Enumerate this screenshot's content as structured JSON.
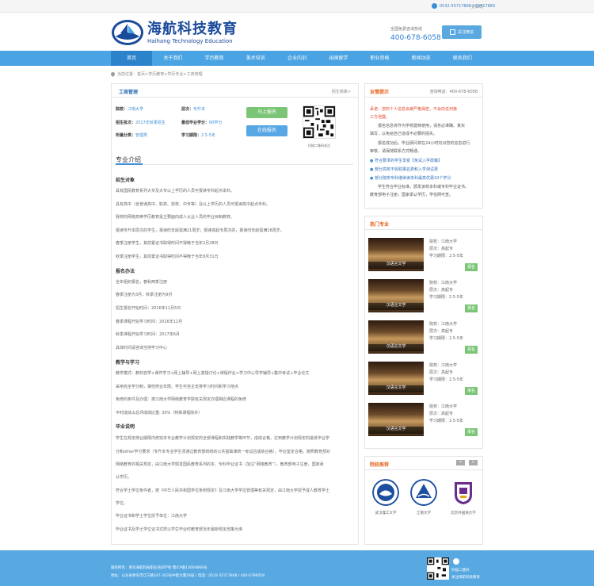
{
  "topbar": {
    "links": "分公司",
    "phone": "0532-55717868 / 55717883"
  },
  "logo": {
    "cn": "海航科技教育",
    "en": "Haihang Technology Education"
  },
  "hotline": {
    "label": "全国免费咨询热线",
    "number": "400-678-6058"
  },
  "follow_label": "关注微信",
  "nav": [
    "首页",
    "关于我们",
    "学历教育",
    "美术培训",
    "企业内训",
    "出国留学",
    "职业资格",
    "新闻动态",
    "联系我们"
  ],
  "breadcrumb": "当前位置：首页>学历教育>学历专业>工商管理",
  "program": {
    "title": "工商管理",
    "more": "招生简章>",
    "school_label": "院校：",
    "school": "江南大学",
    "level_label": "层次：",
    "level": "专升本",
    "batch_label": "招生批次：",
    "batch": "2017年秋季招生",
    "min_credit_label": "最低毕业学分：",
    "min_credit": "80学分",
    "category_label": "所属分类：",
    "category": "管理类",
    "duration_label": "学习期限：",
    "duration": "2.5-5年",
    "apply_btn": "马上报名",
    "online_btn": "在线报名",
    "qr_caption": "扫描二维码关注"
  },
  "intro": {
    "title": "专业介绍",
    "h1": "招生对象",
    "p1": "具有国民教育系列大专及大专以上学历的人员可报读专科起点本科。",
    "p2": "具有高中（含普通高中、职高、技校、中专等）及以上学历的人员可报读高中起点专科。",
    "p3": "我校的网络高等学历教育是主要面向成人从业人员的毕业目制教育。",
    "p4": "报读专升本层次的学生，报读时年龄需满21周岁；报读高起专层次的，报读时年龄需满18周岁。",
    "p5": "春季注册学生，其前置证书取得时间不得晚于当年2月28日",
    "p6": "秋季注册学生，其前置证书取得时间不得晚于当年8月31日",
    "h2": "报名办法",
    "p7": "全年组织报名，春秋两季注册",
    "p8": "春季注册为3月，秋季注册为9月",
    "p9": "招生报名开始时间：2016年11月5日",
    "p10": "春季课程开始学习时间：2016年12月",
    "p11": "秋季课程开始学习时间：2017年6月",
    "p12": "具体时间请咨询当地学习中心",
    "h3": "教学与学习",
    "p13": "教学模式：教材自学+课件学习+网上辅导+网上答疑讨论+课程作业+学习中心导学辅导+集中考试+毕业论文",
    "p14": "采用完全学分制，弹性修业年限。学生可自主安排学习时间和学习地点",
    "p15": "免修的条件及办理：按江南大学网络教育学院有关规定办理相应课程的免修",
    "p16": "平时成绩占总评成绩比重: 30%（特殊课程除外）",
    "h4": "毕业说明",
    "p17": "学生在规定修业期限内修完本专业教学计划规定的全部课程和实践教学等环节，成绩合格，达到教学计划规定的最低毕业学",
    "p18": "分和other学分要求（专升本专业学生须通过教育部统统的公共基础课统一考试且成绩合格），毕业鉴定合格，按照教育部对",
    "p19": "网络教育的相关规定，由江南大学颁发国民教育系列的本、专科毕业证书（加注“网络教育”），教育部电子注册，国家承",
    "p20": "认学历。",
    "p21": "符合学士学位条件者，按《中华人民共和国学位条例规定》及江南大学学位管理等有关规定，由江南大学授予成人教育学士",
    "p22": "学位。",
    "p23": "毕业证书和学士学位授予单位：江南大学",
    "p24": "毕业证书及学士学位证书式样以学生毕业时教育部当年最新规定改策为准"
  },
  "notice": {
    "title": "友情提示",
    "phone": "咨询电话：400-678-6058",
    "w1": "承诺：您的个人信息会被严格保密，不会向任何第",
    "w2": "三方泄露。",
    "t1": "报名信息将作为学校建档使用，请务必准确、真实",
    "t2": "填写，以免给自己造成不必要的损失。",
    "t3": "报名成功后，毕业顾问将在24小时内对您的信息进行",
    "t4": "审核，请保持联系方式畅通。",
    "l1": "符合要求的学生享受【免试入学政策】",
    "l2": "部分高校不收取报名费和入学测试费",
    "l3": "部分院校专科继续读本科最高优惠10个学分",
    "t5": "学生符合毕业标准，颁发该校本科或专科毕业证书，",
    "t6": "教育部电子注册，国家承认学历，学信网可查。"
  },
  "hot": {
    "title": "热门专业",
    "items": [
      {
        "img": "汉语言文学",
        "school": "院校：江南大学",
        "level": "层次：高起专",
        "dur": "学习期限：2.5-5年",
        "btn": "报名"
      },
      {
        "img": "汉语言文学",
        "school": "院校：江南大学",
        "level": "层次：高起专",
        "dur": "学习期限：2.5-5年",
        "btn": "报名"
      },
      {
        "img": "汉语言文学",
        "school": "院校：江南大学",
        "level": "层次：高起专",
        "dur": "学习期限：2.5-5年",
        "btn": "报名"
      },
      {
        "img": "汉语言文学",
        "school": "院校：江南大学",
        "level": "层次：高起专",
        "dur": "学习期限：2.5-5年",
        "btn": "报名"
      },
      {
        "img": "汉语言文学",
        "school": "院校：江南大学",
        "level": "层次：高起专",
        "dur": "学习期限：2.5-5年",
        "btn": "报名"
      }
    ]
  },
  "recommend": {
    "title": "院校推荐",
    "prev": "<",
    "next": ">",
    "schools": [
      "武汉理工大学",
      "江南大学",
      "北京外国语大学"
    ]
  },
  "footer": {
    "l1": "版权所有：青岛海航科技职业培训学校  鲁ICP备13004868号",
    "l2": "地址：山东省青岛市辽宁路247-263号中影大厦26层 | 电话：0532-55717868 / 400-6786058",
    "qr_cap1": "扫描二维码",
    "qr_cap2": "关注海航科技教育"
  },
  "colors": {
    "primary": "#4aa3e2",
    "accent": "#e6631f",
    "green": "#7cc576"
  }
}
